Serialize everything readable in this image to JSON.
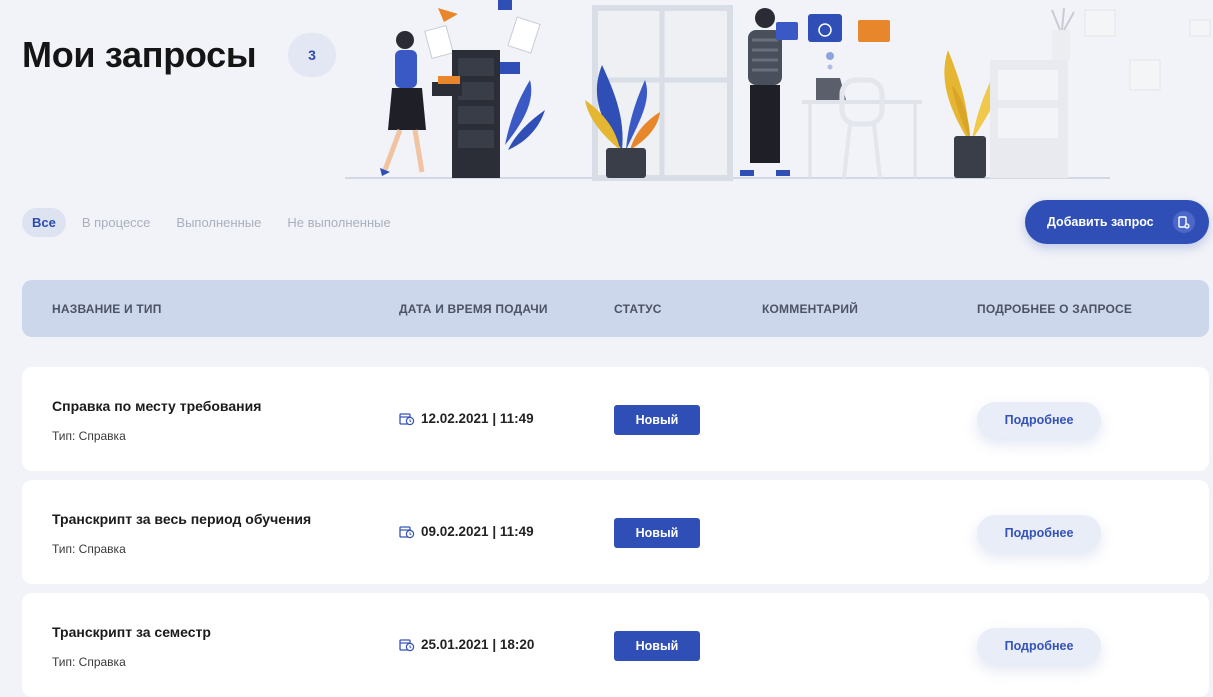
{
  "header": {
    "title": "Мои запросы",
    "count": "3"
  },
  "tabs": [
    {
      "label": "Все",
      "active": true
    },
    {
      "label": "В процессе",
      "active": false
    },
    {
      "label": "Выполненные",
      "active": false
    },
    {
      "label": "Не выполненные",
      "active": false
    }
  ],
  "add_button": {
    "label": "Добавить запрос",
    "icon": "add-document-icon"
  },
  "table": {
    "columns": [
      "НАЗВАНИЕ И ТИП",
      "ДАТА И ВРЕМЯ ПОДАЧИ",
      "СТАТУС",
      "КОММЕНТАРИЙ",
      "ПОДРОБНЕЕ О ЗАПРОСЕ"
    ],
    "rows": [
      {
        "title": "Справка по месту требования",
        "type": "Тип: Справка",
        "datetime": "12.02.2021 | 11:49",
        "status": "Новый",
        "comment": "",
        "details": "Подробнее"
      },
      {
        "title": "Транскрипт за весь период обучения",
        "type": "Тип: Справка",
        "datetime": "09.02.2021 | 11:49",
        "status": "Новый",
        "comment": "",
        "details": "Подробнее"
      },
      {
        "title": "Транскрипт за семестр",
        "type": "Тип: Справка",
        "datetime": "25.01.2021 | 18:20",
        "status": "Новый",
        "comment": "",
        "details": "Подробнее"
      }
    ]
  },
  "colors": {
    "accent": "#2f4fb6",
    "background": "#f1f3f8",
    "table_header": "#cdd7ec"
  }
}
